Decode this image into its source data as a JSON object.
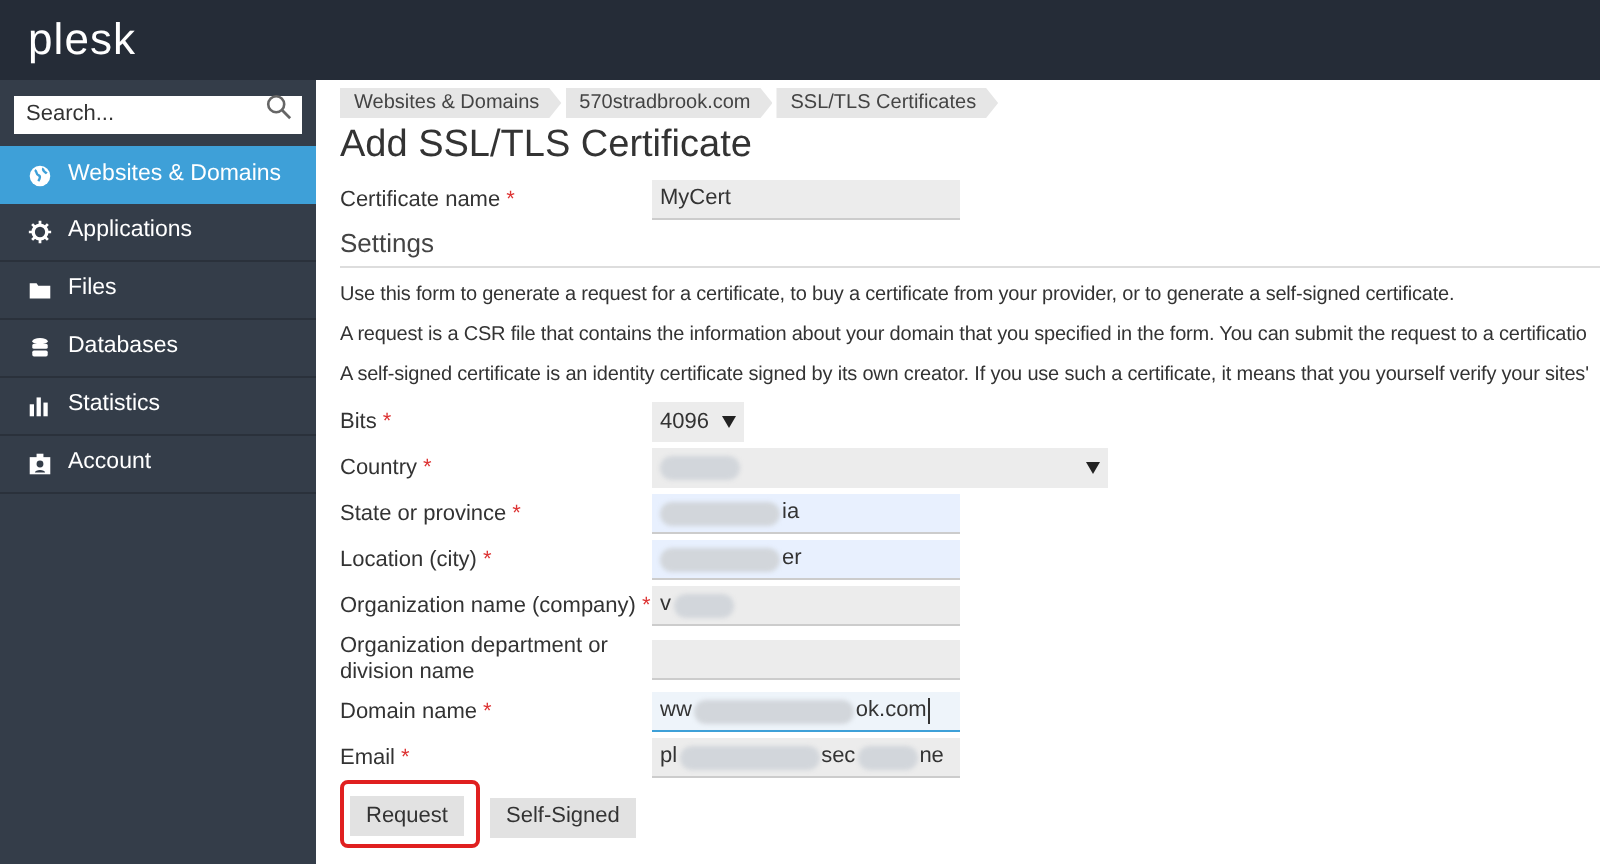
{
  "header": {
    "logo": "plesk"
  },
  "sidebar": {
    "search": {
      "placeholder": "Search..."
    },
    "items": [
      {
        "label": "Websites & Domains",
        "selected": true
      },
      {
        "label": "Applications",
        "selected": false
      },
      {
        "label": "Files",
        "selected": false
      },
      {
        "label": "Databases",
        "selected": false
      },
      {
        "label": "Statistics",
        "selected": false
      },
      {
        "label": "Account",
        "selected": false
      }
    ]
  },
  "breadcrumbs": [
    "Websites & Domains",
    "570stradbrook.com",
    "SSL/TLS Certificates"
  ],
  "title": "Add SSL/TLS Certificate",
  "certificate_name": {
    "label": "Certificate name",
    "required_mark": "*",
    "value": "MyCert"
  },
  "section": "Settings",
  "paragraphs": [
    "Use this form to generate a request for a certificate, to buy a certificate from your provider, or to generate a self-signed certificate.",
    "A request is a CSR file that contains the information about your domain that you specified in the form. You can submit the request to a certificatio",
    "A self-signed certificate is an identity certificate signed by its own creator. If you use such a certificate, it means that you yourself verify your sites'"
  ],
  "fields": [
    {
      "kind": "select",
      "label": "Bits",
      "required_mark": "*",
      "parts": [
        "4096"
      ]
    },
    {
      "kind": "select_wide",
      "label": "Country",
      "required_mark": "*",
      "parts": [
        {
          "kind": "blur"
        }
      ]
    },
    {
      "kind": "text_autofill",
      "label": "State or province",
      "required_mark": "*",
      "parts": [
        {
          "kind": "blur"
        },
        "ia"
      ]
    },
    {
      "kind": "text_autofill",
      "label": "Location (city)",
      "required_mark": "*",
      "parts": [
        {
          "kind": "blur"
        },
        "er"
      ]
    },
    {
      "kind": "text",
      "label": "Organization name (company)",
      "required_mark": "*",
      "parts": [
        "v",
        {
          "kind": "blur"
        }
      ]
    },
    {
      "kind": "text",
      "label": "Organization department or division name"
    },
    {
      "kind": "text_focused",
      "label": "Domain name",
      "required_mark": "*",
      "parts": [
        "ww",
        {
          "kind": "blur"
        },
        "ok.com"
      ]
    },
    {
      "kind": "text",
      "label": "Email",
      "required_mark": "*",
      "parts": [
        "pl",
        {
          "kind": "blur"
        },
        "sec",
        {
          "kind": "blur"
        },
        "ne"
      ]
    }
  ],
  "buttons": [
    {
      "label": "Request",
      "highlighted": true
    },
    {
      "label": "Self-Signed",
      "highlighted": false
    }
  ]
}
